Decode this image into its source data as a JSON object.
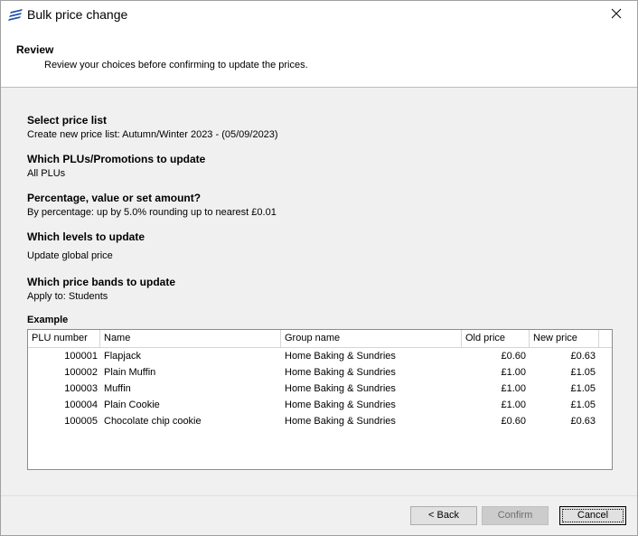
{
  "window": {
    "title": "Bulk price change"
  },
  "header": {
    "title": "Review",
    "subtitle": "Review your choices before confirming to update the prices."
  },
  "sections": [
    {
      "title": "Select price list",
      "value": "Create new price list: Autumn/Winter 2023 - (05/09/2023)"
    },
    {
      "title": "Which PLUs/Promotions to update",
      "value": "All PLUs"
    },
    {
      "title": "Percentage, value or set amount?",
      "value": "By percentage: up by 5.0% rounding up to nearest £0.01"
    },
    {
      "title": "Which levels to update",
      "value": "Update global price"
    },
    {
      "title": "Which price bands to update",
      "value": "Apply to: Students"
    }
  ],
  "example": {
    "title": "Example",
    "columns": [
      "PLU number",
      "Name",
      "Group name",
      "Old price",
      "New price"
    ],
    "rows": [
      [
        "100001",
        "Flapjack",
        "Home Baking & Sundries",
        "£0.60",
        "£0.63"
      ],
      [
        "100002",
        "Plain Muffin",
        "Home Baking & Sundries",
        "£1.00",
        "£1.05"
      ],
      [
        "100003",
        "Muffin",
        "Home Baking & Sundries",
        "£1.00",
        "£1.05"
      ],
      [
        "100004",
        "Plain Cookie",
        "Home Baking & Sundries",
        "£1.00",
        "£1.05"
      ],
      [
        "100005",
        "Chocolate chip cookie",
        "Home Baking & Sundries",
        "£0.60",
        "£0.63"
      ]
    ]
  },
  "buttons": {
    "back": "< Back",
    "confirm": "Confirm",
    "cancel": "Cancel"
  },
  "icons": {
    "app": "app-logo-icon",
    "close": "close-icon"
  },
  "colors": {
    "accent": "#1e4fa8",
    "header_bg": "#ffffff",
    "body_bg": "#f0f0f0"
  }
}
